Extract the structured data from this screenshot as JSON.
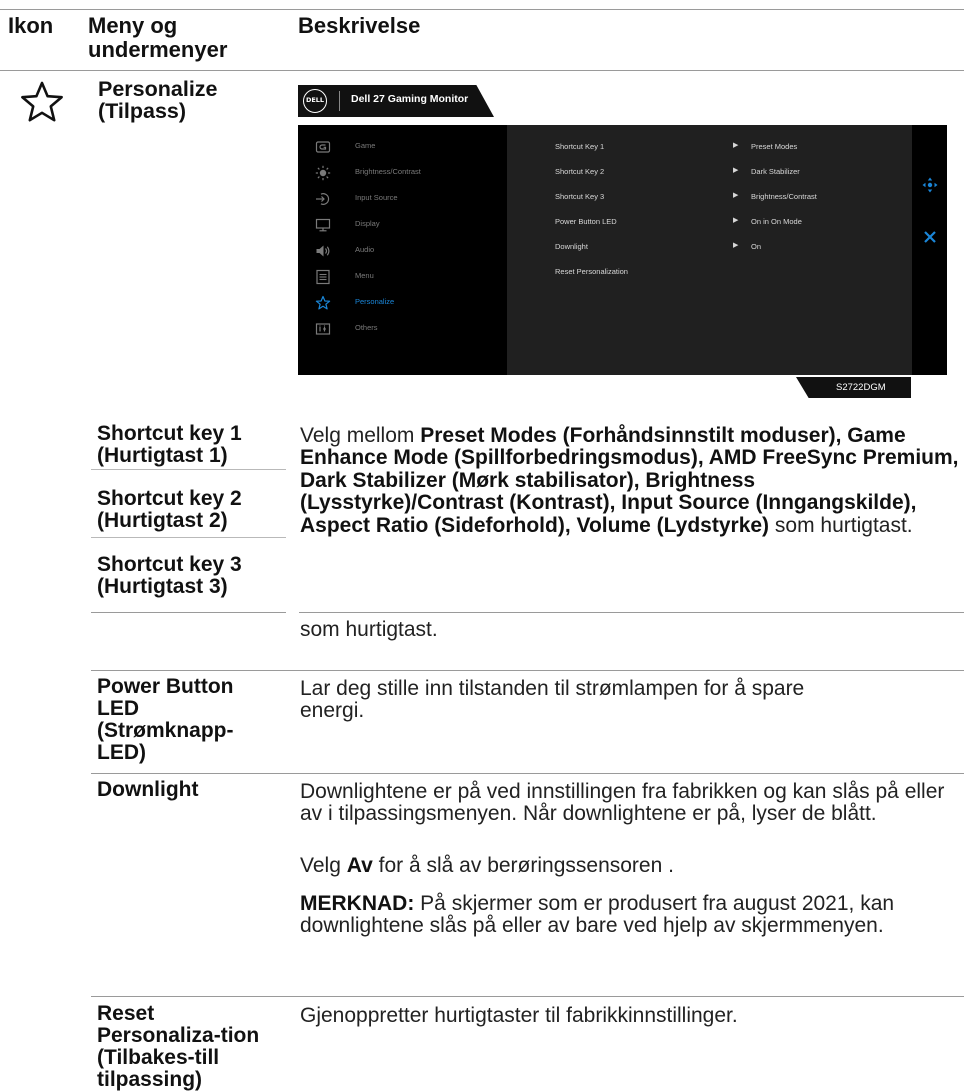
{
  "header": {
    "col_icon": "Ikon",
    "col_menu": "Meny og undermenyer",
    "col_desc": "Beskrivelse"
  },
  "section": {
    "icon": "star-outline-icon",
    "title": "Personalize (Tilpass)"
  },
  "osd": {
    "logo_text": "DELL",
    "title": "Dell 27 Gaming Monitor",
    "model": "S2722DGM",
    "accent_color": "#1a86d8",
    "menu": [
      {
        "icon": "game-icon",
        "label": "Game"
      },
      {
        "icon": "brightness-icon",
        "label": "Brightness/Contrast"
      },
      {
        "icon": "input-source-icon",
        "label": "Input Source"
      },
      {
        "icon": "display-icon",
        "label": "Display"
      },
      {
        "icon": "audio-icon",
        "label": "Audio"
      },
      {
        "icon": "menu-icon",
        "label": "Menu"
      },
      {
        "icon": "star-icon",
        "label": "Personalize"
      },
      {
        "icon": "others-icon",
        "label": "Others"
      }
    ],
    "active_menu": "Personalize",
    "settings": [
      {
        "label": "Shortcut Key 1",
        "value": "Preset Modes"
      },
      {
        "label": "Shortcut Key 2",
        "value": "Dark Stabilizer"
      },
      {
        "label": "Shortcut Key 3",
        "value": "Brightness/Contrast"
      },
      {
        "label": "Power Button LED",
        "value": "On in On Mode"
      },
      {
        "label": "Downlight",
        "value": "On"
      },
      {
        "label": "Reset Personalization",
        "value": ""
      }
    ],
    "nav_icons": [
      "move-icon",
      "close-icon"
    ]
  },
  "rows": {
    "shortcut1": "Shortcut key 1 (Hurtigtast 1)",
    "shortcut2": "Shortcut key 2 (Hurtigtast 2)",
    "shortcut3": "Shortcut key 3 (Hurtigtast 3)",
    "shortcut_desc_prefix": "Velg mellom",
    "shortcut_desc_bold": "Preset Modes (Forhåndsinnstilt moduser), Game Enhance Mode (Spillforbedringsmodus), AMD FreeSync Premium, Dark Stabilizer (Mørk stabilisator), Brightness (Lysstyrke)/Contrast (Kontrast), Input Source (Inngangskilde), Aspect Ratio (Sideforhold), Volume (Lydstyrke)",
    "shortcut_desc_suffix": "som hurtigtast.",
    "shortcut_desc_repeat": "som hurtigtast.",
    "power_led": "Power Button LED (Strømknapp-LED)",
    "power_led_desc": "Lar deg stille inn tilstanden til strømlampen for å spare energi.",
    "downlight": "Downlight",
    "downlight_desc1": "Downlightene er på ved innstillingen fra fabrikken og kan slås på eller av i tilpassingsmenyen. Når downlightene er på, lyser de blått.",
    "downlight_desc2_prefix": "Velg",
    "downlight_desc2_bold": "Av",
    "downlight_desc2_suffix": "for å slå av berøringssensoren .",
    "note_label": "MERKNAD:",
    "note_text": "På skjermer som er produsert fra august 2021, kan downlightene slås på eller av bare ved hjelp av skjermmenyen.",
    "reset": "Reset Personaliza-tion (Tilbakes-till tilpassing)",
    "reset_desc": "Gjenoppretter hurtigtaster til fabrikkinnstillinger."
  }
}
